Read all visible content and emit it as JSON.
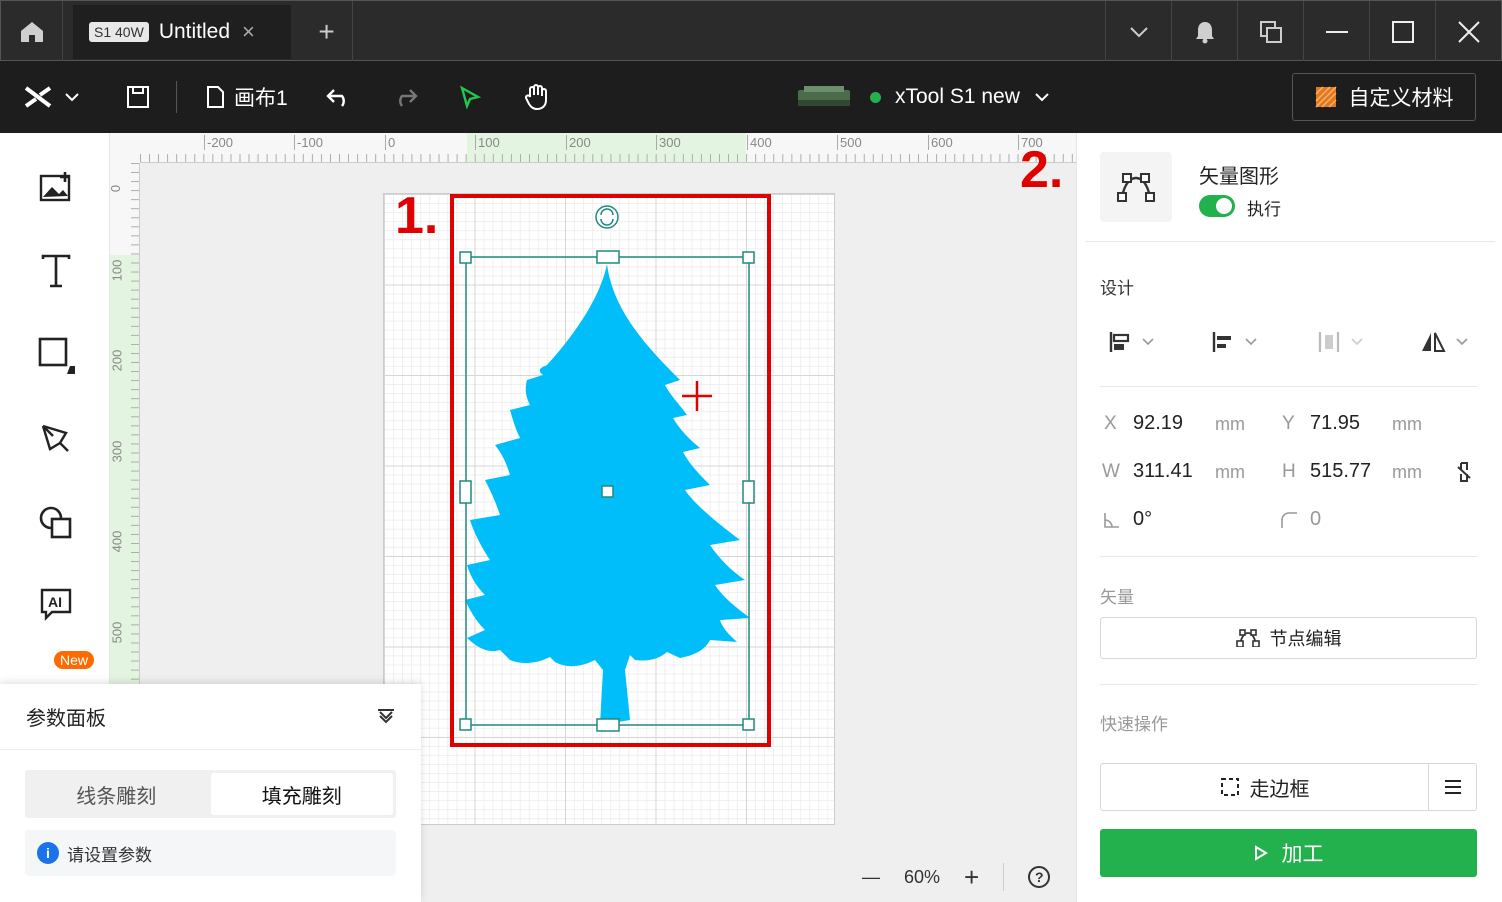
{
  "titlebar": {
    "tab_badge": "S1 40W",
    "tab_title": "Untitled",
    "tab_close": "×",
    "new_tab": "+"
  },
  "toolbar": {
    "canvas_name": "画布1",
    "device_name": "xTool S1 new",
    "device_status_color": "#22b14c",
    "material_button": "自定义材料"
  },
  "sidebar": {
    "new_badge": "New",
    "items": [
      "image-icon",
      "text-icon",
      "shape-icon",
      "pen-icon",
      "combine-icon",
      "ai-icon"
    ]
  },
  "rulers": {
    "horizontal": [
      "-200",
      "-100",
      "0",
      "100",
      "200",
      "300",
      "400",
      "500",
      "600",
      "700"
    ],
    "vertical": [
      "0",
      "100",
      "200",
      "300",
      "400",
      "500"
    ]
  },
  "annotations": {
    "label_1": "1.",
    "label_2": "2."
  },
  "zoom": {
    "minus": "—",
    "level": "60%",
    "plus": "+",
    "help": "?"
  },
  "param_panel": {
    "title": "参数面板",
    "tabs": [
      "线条雕刻",
      "填充雕刻"
    ],
    "active_tab": "填充雕刻",
    "hint": "请设置参数"
  },
  "right_panel": {
    "object_type": "矢量图形",
    "execute_label": "执行",
    "execute_on": true,
    "design_heading": "设计",
    "x_label": "X",
    "x_value": "92.19",
    "x_unit": "mm",
    "y_label": "Y",
    "y_value": "71.95",
    "y_unit": "mm",
    "w_label": "W",
    "w_value": "311.41",
    "w_unit": "mm",
    "h_label": "H",
    "h_value": "515.77",
    "h_unit": "mm",
    "rotation": "0°",
    "corner_radius": "0",
    "vector_heading": "矢量",
    "node_edit": "节点编辑",
    "quick_heading": "快速操作",
    "frame_button": "走边框",
    "process_button": "加工"
  }
}
